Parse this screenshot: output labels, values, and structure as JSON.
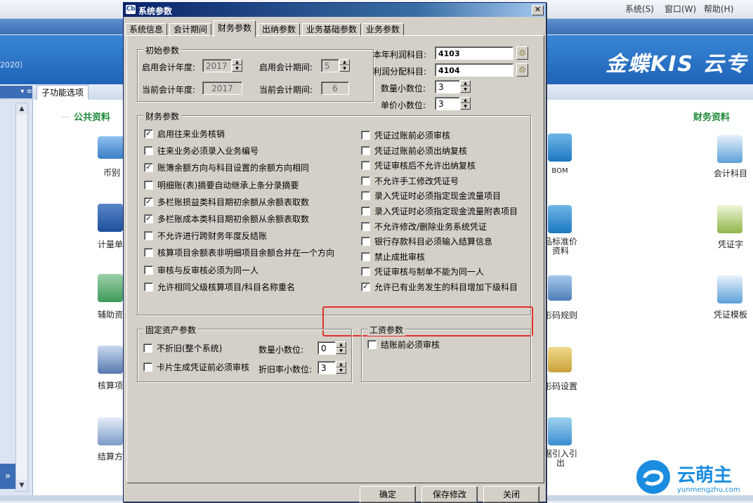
{
  "background": {
    "menu": [
      "系统(S)",
      "窗口(W)",
      "帮助(H)"
    ],
    "year_text": "2020）",
    "logo_text": "金蝶KIS 云专",
    "subtab": "子功能选项",
    "left_group": "公共资料",
    "right_group": "财务资料",
    "left_items": [
      "币别",
      "计量单",
      "辅助资",
      "核算项",
      "结算方"
    ],
    "middle_items": [
      "BOM",
      "品标准价\n资料",
      "形码规则",
      "形码设置",
      "据引入引\n出"
    ],
    "right_items": [
      "会计科目",
      "凭证字",
      "凭证模板"
    ],
    "watermark": {
      "name": "云萌主",
      "url": "yunmengzhu.com"
    }
  },
  "dialog": {
    "title": "系统参数",
    "tabs": [
      "系统信息",
      "会计期间",
      "财务参数",
      "出纳参数",
      "业务基础参数",
      "业务参数"
    ],
    "active_tab": "财务参数",
    "initial": {
      "group_title": "初始参数",
      "start_year_label": "启用会计年度:",
      "start_year_value": "2017",
      "start_period_label": "启用会计期间:",
      "start_period_value": "5",
      "current_year_label": "当前会计年度:",
      "current_year_value": "2017",
      "current_period_label": "当前会计期间:",
      "current_period_value": "6"
    },
    "accounts": {
      "profit_label": "本年利润科目:",
      "profit_value": "4103",
      "distribution_label": "利润分配科目:",
      "distribution_value": "4104",
      "qty_decimals_label": "数量小数位:",
      "qty_decimals_value": "3",
      "price_decimals_label": "单价小数位:",
      "price_decimals_value": "3"
    },
    "finance": {
      "group_title": "财务参数",
      "left_options": [
        {
          "label": "启用往来业务核销",
          "checked": true
        },
        {
          "label": "往来业务必须录入业务编号",
          "checked": false
        },
        {
          "label": "账簿余额方向与科目设置的余额方向相同",
          "checked": true
        },
        {
          "label": "明细账(表)摘要自动继承上条分录摘要",
          "checked": false
        },
        {
          "label": "多栏账损益类科目期初余额从余额表取数",
          "checked": true
        },
        {
          "label": "多栏账成本类科目期初余额从余额表取数",
          "checked": true
        },
        {
          "label": "不允许进行跨财务年度反结账",
          "checked": false
        },
        {
          "label": "核算项目余额表非明细项目余额合并在一个方向",
          "checked": false
        },
        {
          "label": "审核与反审核必须为同一人",
          "checked": false
        },
        {
          "label": "允许相同父级核算项目/科目名称重名",
          "checked": false
        }
      ],
      "right_options": [
        {
          "label": "凭证过账前必须审核",
          "checked": false
        },
        {
          "label": "凭证过账前必须出纳复核",
          "checked": false
        },
        {
          "label": "凭证审核后不允许出纳复核",
          "checked": false
        },
        {
          "label": "不允许手工修改凭证号",
          "checked": false
        },
        {
          "label": "录入凭证时必须指定现金流量项目",
          "checked": false
        },
        {
          "label": "录入凭证时必须指定现金流量附表项目",
          "checked": false
        },
        {
          "label": "不允许修改/删除业务系统凭证",
          "checked": false
        },
        {
          "label": "银行存款科目必须输入结算信息",
          "checked": false
        },
        {
          "label": "禁止成批审核",
          "checked": false
        },
        {
          "label": "凭证审核与制单不能为同一人",
          "checked": false
        },
        {
          "label": "允许已有业务发生的科目增加下级科目",
          "checked": true
        }
      ]
    },
    "fixed_assets": {
      "group_title": "固定资产参数",
      "no_depreciation": {
        "label": "不折旧(整个系统)",
        "checked": false
      },
      "card_voucher": {
        "label": "卡片生成凭证前必须审核",
        "checked": false
      },
      "qty_decimals_label": "数量小数位:",
      "qty_decimals_value": "0",
      "dep_rate_decimals_label": "折旧率小数位:",
      "dep_rate_decimals_value": "3"
    },
    "payroll": {
      "group_title": "工资参数",
      "audit_before_close": {
        "label": "结账前必须审核",
        "checked": false
      }
    },
    "buttons": {
      "ok": "确定",
      "save": "保存修改",
      "close": "关闭"
    },
    "highlight_color": "#e0302a"
  }
}
